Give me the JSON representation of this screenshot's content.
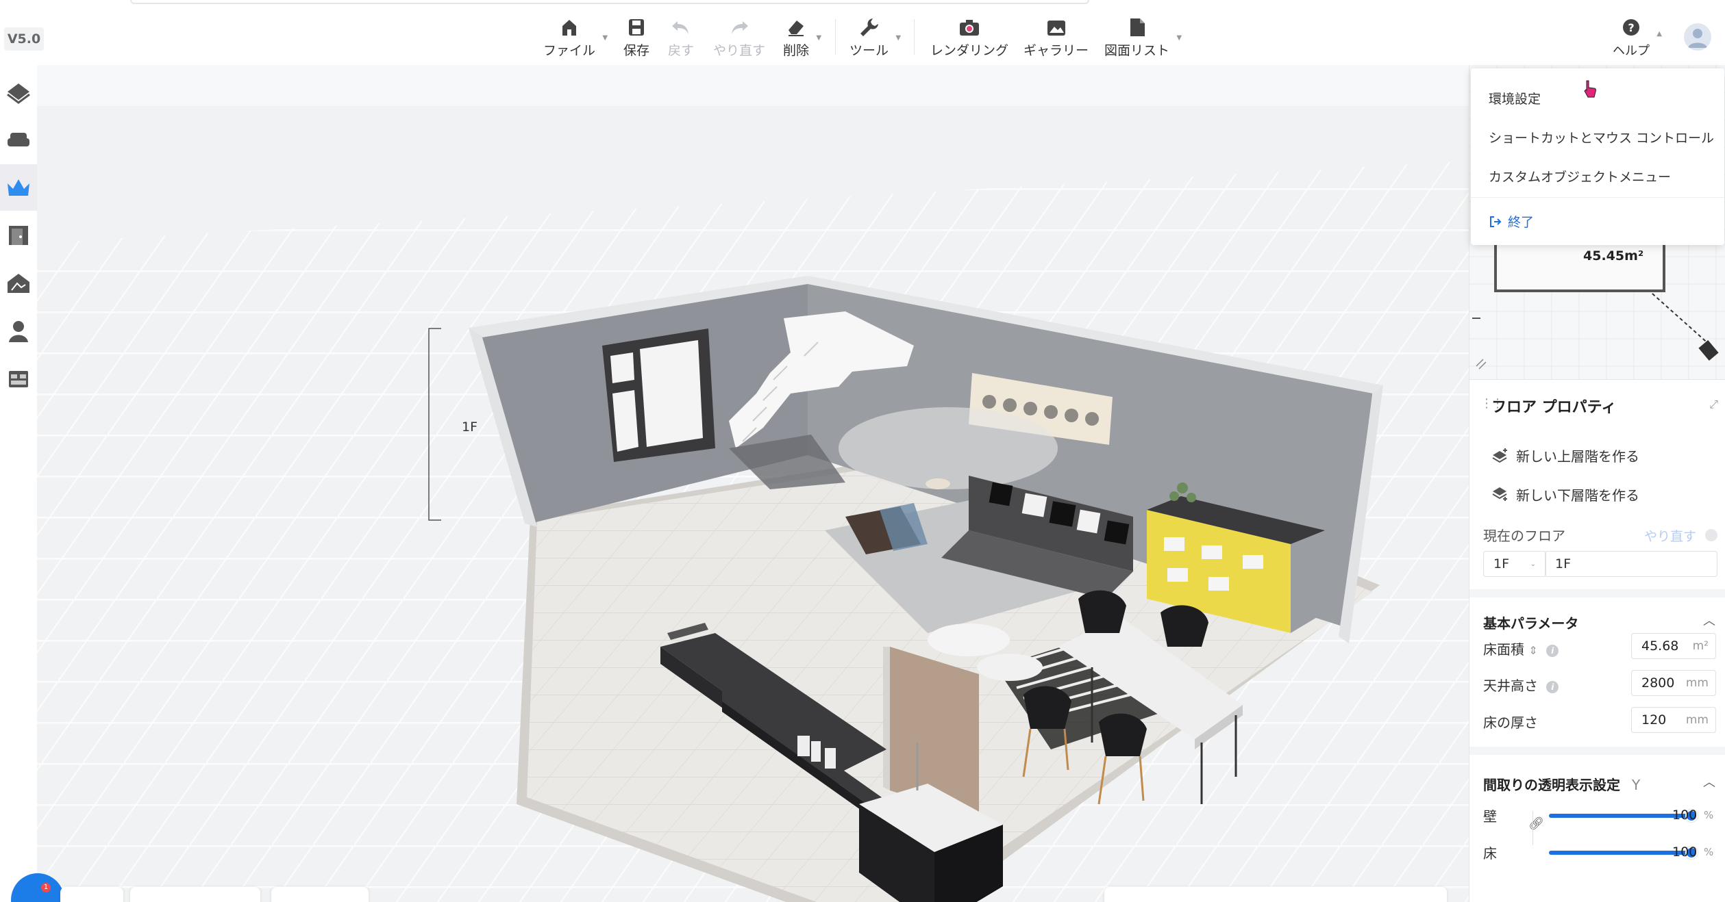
{
  "version": "V5.0",
  "toolbar": {
    "file": "ファイル",
    "save": "保存",
    "undo": "戻す",
    "redo": "やり直す",
    "delete": "削除",
    "tools": "ツール",
    "rendering": "レンダリング",
    "gallery": "ギャラリー",
    "drawing_list": "図面リスト",
    "help": "ヘルプ"
  },
  "help_menu": {
    "items": [
      "環境設定",
      "ショートカットとマウス コントロール",
      "カスタムオブジェクトメニュー"
    ],
    "exit": "終了"
  },
  "viewport": {
    "floor_label": "1F"
  },
  "minimap": {
    "area": "45.45m²"
  },
  "floor_properties": {
    "title": "フロア プロパティ",
    "new_upper": "新しい上層階を作る",
    "new_lower": "新しい下層階を作る",
    "current_floor_label": "現在のフロア",
    "redo": "やり直す",
    "floor_select": "1F",
    "floor_name": "1F"
  },
  "basic_params": {
    "title": "基本パラメータ",
    "floor_area_label": "床面積",
    "floor_area_value": "45.68",
    "floor_area_unit": "m²",
    "ceiling_label": "天井高さ",
    "ceiling_value": "2800",
    "ceiling_unit": "mm",
    "thickness_label": "床の厚さ",
    "thickness_value": "120",
    "thickness_unit": "mm"
  },
  "transparency": {
    "title": "間取りの透明表示設定",
    "shortcut": "Y",
    "wall_label": "壁",
    "wall_value": "100",
    "wall_level": 1.0,
    "floor_label": "床",
    "floor_value": "100",
    "floor_level": 1.0,
    "unit": "%"
  },
  "colors": {
    "accent": "#1b6fe0",
    "wall": "#8f9399",
    "floor_tile": "#e8e6e2",
    "sofa": "#4a4a4c",
    "cabinet_yellow": "#ecd94a"
  }
}
